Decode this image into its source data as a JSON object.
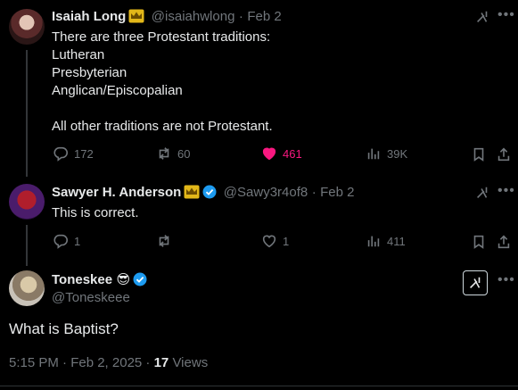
{
  "tweets": [
    {
      "name": "Isaiah Long",
      "handle": "@isaiahwlong",
      "sep": "·",
      "date": "Feb 2",
      "text": "There are three Protestant traditions:\nLutheran\nPresbyterian\nAnglican/Episcopalian\n\nAll other traditions are not Protestant.",
      "replies": "172",
      "reposts": "60",
      "likes": "461",
      "views": "39K",
      "liked": true
    },
    {
      "name": "Sawyer H. Anderson",
      "handle": "@Sawy3r4of8",
      "sep": "·",
      "date": "Feb 2",
      "text": "This is correct.",
      "replies": "1",
      "reposts": "",
      "likes": "1",
      "views": "411",
      "liked": false
    }
  ],
  "main_tweet": {
    "name": "Toneskee",
    "emoji": "😎",
    "handle": "@Toneskeee",
    "text": "What is Baptist?",
    "timestamp": "5:15 PM · Feb 2, 2025 ·",
    "views_count": "17",
    "views_label": "Views"
  },
  "colors": {
    "background": "#000000",
    "text": "#e7e9ea",
    "muted": "#71767b",
    "like": "#f91880",
    "verified": "#1d9bf0",
    "gold_badge": "#e2b719"
  },
  "icons": [
    "reply-icon",
    "repost-icon",
    "like-icon",
    "views-icon",
    "bookmark-icon",
    "share-icon",
    "grok-icon",
    "more-icon",
    "crown-badge-icon",
    "verified-icon"
  ]
}
